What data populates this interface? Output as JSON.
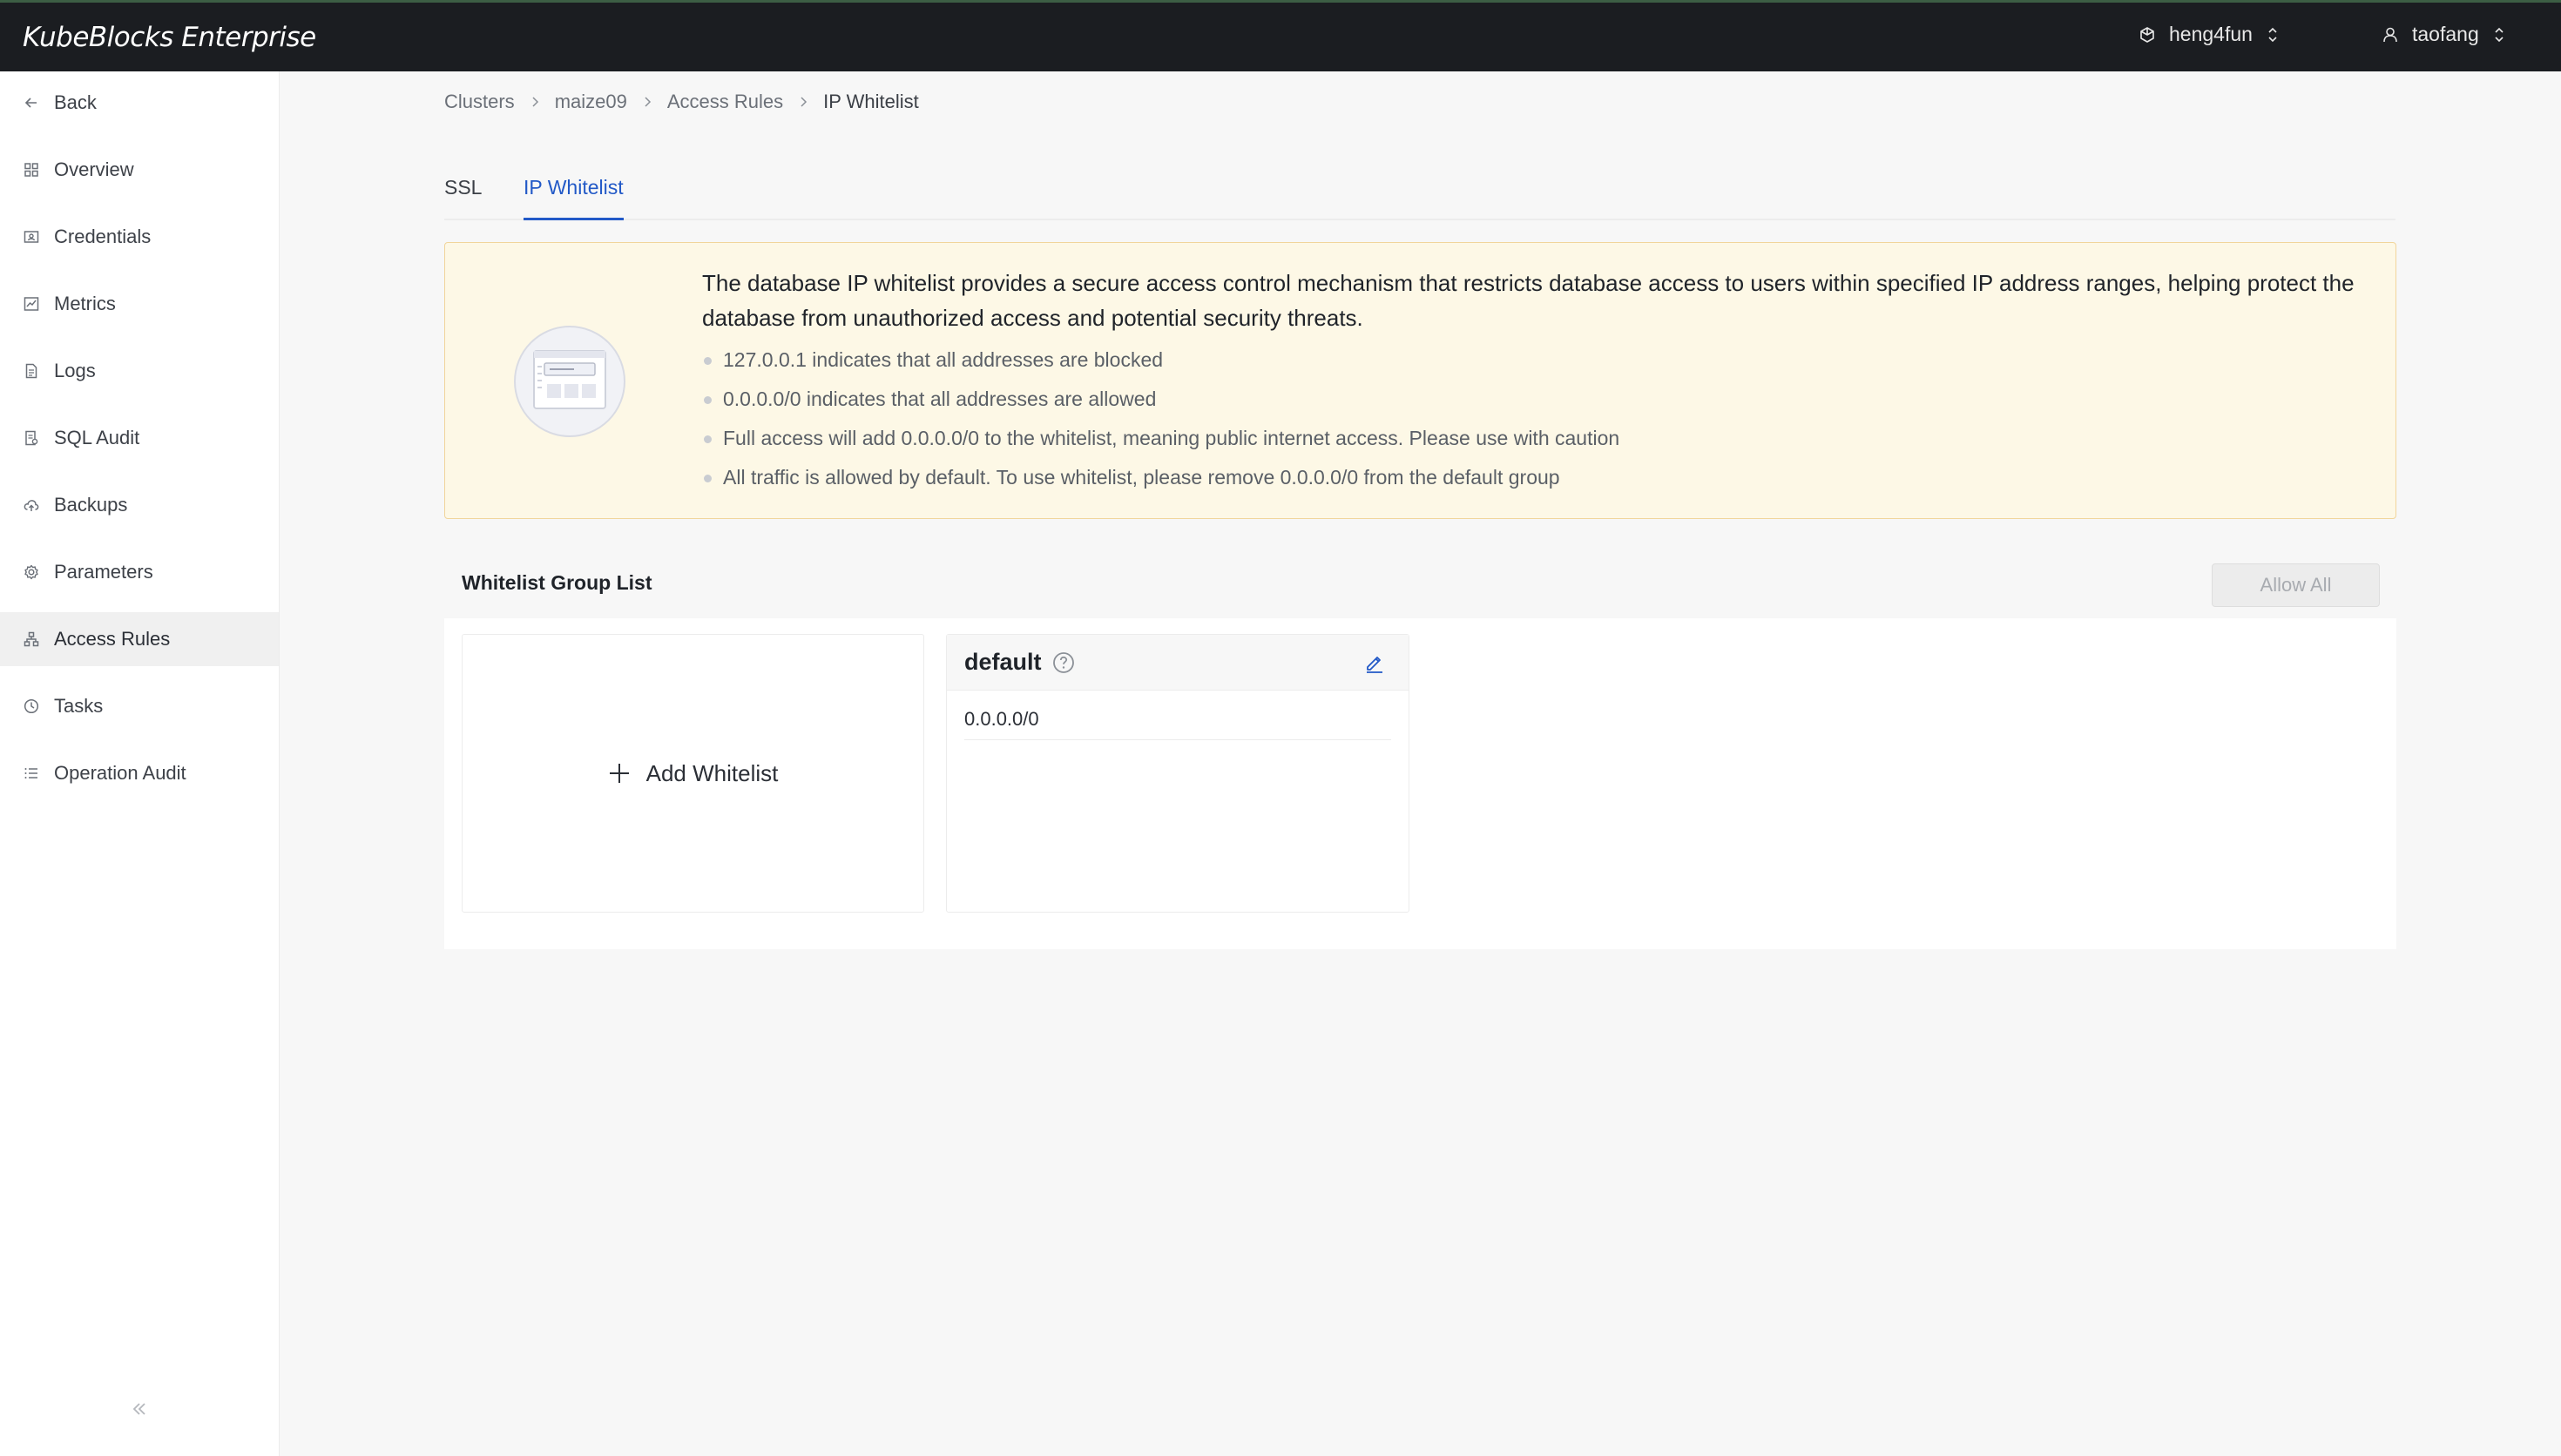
{
  "app": {
    "brand": "KubeBlocks Enterprise"
  },
  "topbar": {
    "workspace": "heng4fun",
    "user": "taofang"
  },
  "sidebar": {
    "items": [
      {
        "label": "Back",
        "icon": "arrow-left-icon"
      },
      {
        "label": "Overview",
        "icon": "grid-icon"
      },
      {
        "label": "Credentials",
        "icon": "id-card-icon"
      },
      {
        "label": "Metrics",
        "icon": "chart-icon"
      },
      {
        "label": "Logs",
        "icon": "document-icon"
      },
      {
        "label": "SQL Audit",
        "icon": "audit-icon"
      },
      {
        "label": "Backups",
        "icon": "cloud-upload-icon"
      },
      {
        "label": "Parameters",
        "icon": "gear-icon"
      },
      {
        "label": "Access Rules",
        "icon": "network-icon",
        "active": true
      },
      {
        "label": "Tasks",
        "icon": "clock-icon"
      },
      {
        "label": "Operation Audit",
        "icon": "list-icon"
      }
    ]
  },
  "breadcrumb": [
    "Clusters",
    "maize09",
    "Access Rules",
    "IP Whitelist"
  ],
  "tabs": [
    {
      "label": "SSL",
      "active": false
    },
    {
      "label": "IP Whitelist",
      "active": true
    }
  ],
  "notice": {
    "lead": "The database IP whitelist provides a secure access control mechanism that restricts database access to users within specified IP address ranges, helping protect the database from unauthorized access and potential security threats.",
    "bullets": [
      "127.0.0.1 indicates that all addresses are blocked",
      "0.0.0.0/0 indicates that all addresses are allowed",
      "Full access will add 0.0.0.0/0 to the whitelist, meaning public internet access. Please use with caution",
      "All traffic is allowed by default. To use whitelist, please remove 0.0.0.0/0 from the default group"
    ]
  },
  "whitelist": {
    "title": "Whitelist Group List",
    "allow_all_label": "Allow All",
    "add_label": "Add Whitelist",
    "groups": [
      {
        "name": "default",
        "ips": [
          "0.0.0.0/0"
        ]
      }
    ]
  },
  "colors": {
    "topbar_bg": "#1b1d21",
    "accent": "#2259c7",
    "notice_bg": "#fdf8e6",
    "notice_border": "#f1d59b"
  }
}
